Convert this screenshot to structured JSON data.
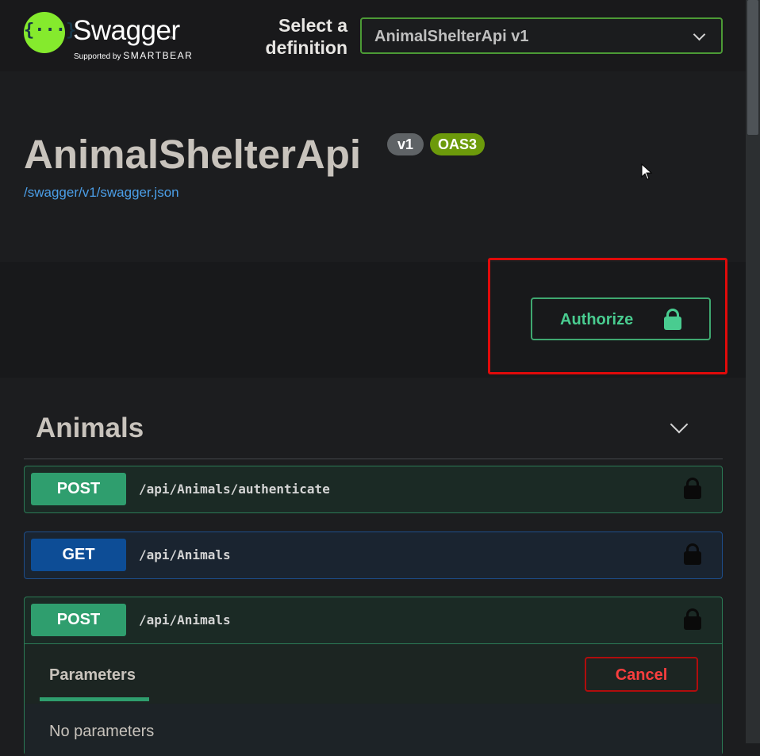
{
  "header": {
    "logo": {
      "name": "Swagger",
      "trademark": "™",
      "supported_by": "Supported by",
      "company": "SMARTBEAR",
      "glyph": "{···}",
      "icon": "swagger-logo-icon",
      "brand_color": "#85ea2d"
    },
    "definition_label": "Select a definition",
    "definition_selected": "AnimalShelterApi v1"
  },
  "info": {
    "title": "AnimalShelterApi",
    "version_badge": "v1",
    "oas_badge": "OAS3",
    "spec_link": "/swagger/v1/swagger.json"
  },
  "auth": {
    "authorize_label": "Authorize",
    "icon": "lock-icon",
    "color": "#49cc90",
    "highlight_color": "#e00a0a"
  },
  "tag": {
    "name": "Animals",
    "collapse_icon": "chevron-down-icon"
  },
  "operations": [
    {
      "method": "POST",
      "path": "/api/Animals/authenticate",
      "color": "#49cc90"
    },
    {
      "method": "GET",
      "path": "/api/Animals",
      "color": "#61affe"
    },
    {
      "method": "POST",
      "path": "/api/Animals",
      "color": "#49cc90"
    }
  ],
  "expanded_operation": {
    "parameters_tab": "Parameters",
    "cancel_label": "Cancel",
    "no_parameters": "No parameters",
    "cancel_color": "#f93e3e"
  }
}
